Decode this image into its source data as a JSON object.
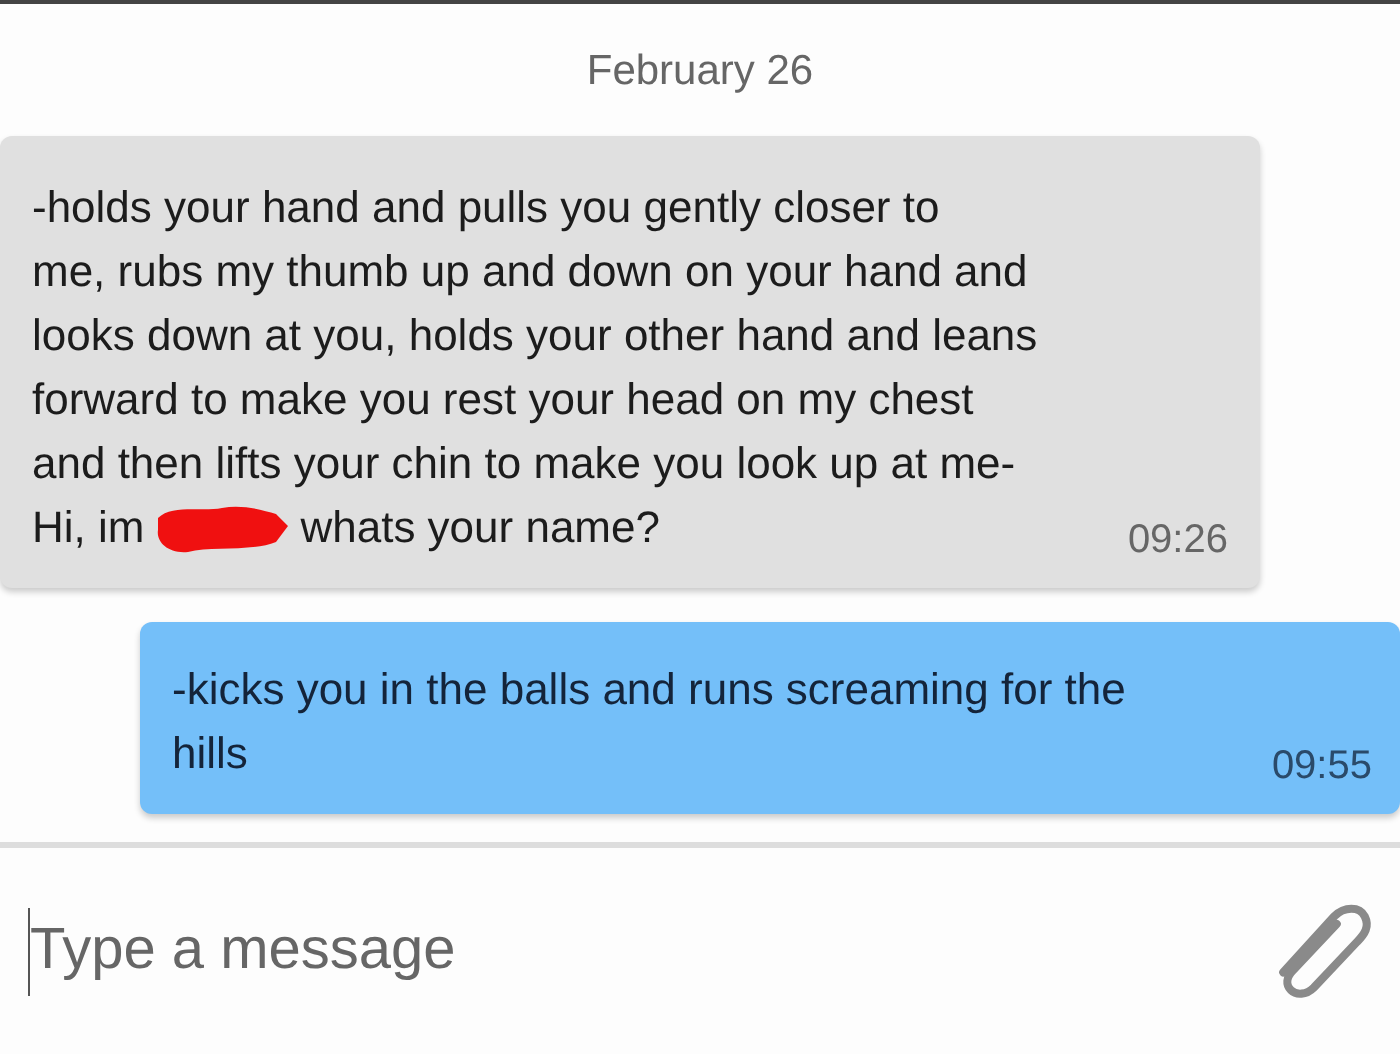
{
  "date_label": "February 26",
  "messages": [
    {
      "kind": "incoming",
      "lines": [
        {
          "text": "-holds your hand and pulls you gently closer to",
          "redacted": false
        },
        {
          "text": "me, rubs my thumb up and down on your hand and",
          "redacted": false
        },
        {
          "text": "looks down at you, holds your other hand and leans",
          "redacted": false
        },
        {
          "text": "forward to make you rest your head on my chest",
          "redacted": false
        },
        {
          "text": "and then lifts your chin to make you look up at me-",
          "redacted": false
        },
        {
          "text": "Hi, im",
          "redacted": true,
          "after": "whats your name?"
        }
      ],
      "time": "09:26"
    },
    {
      "kind": "outgoing",
      "lines": [
        {
          "text": "-kicks you in the balls and runs screaming for the",
          "redacted": false
        },
        {
          "text": "hills",
          "redacted": false
        }
      ],
      "time": "09:55"
    }
  ],
  "composer": {
    "placeholder": "Type a message"
  }
}
